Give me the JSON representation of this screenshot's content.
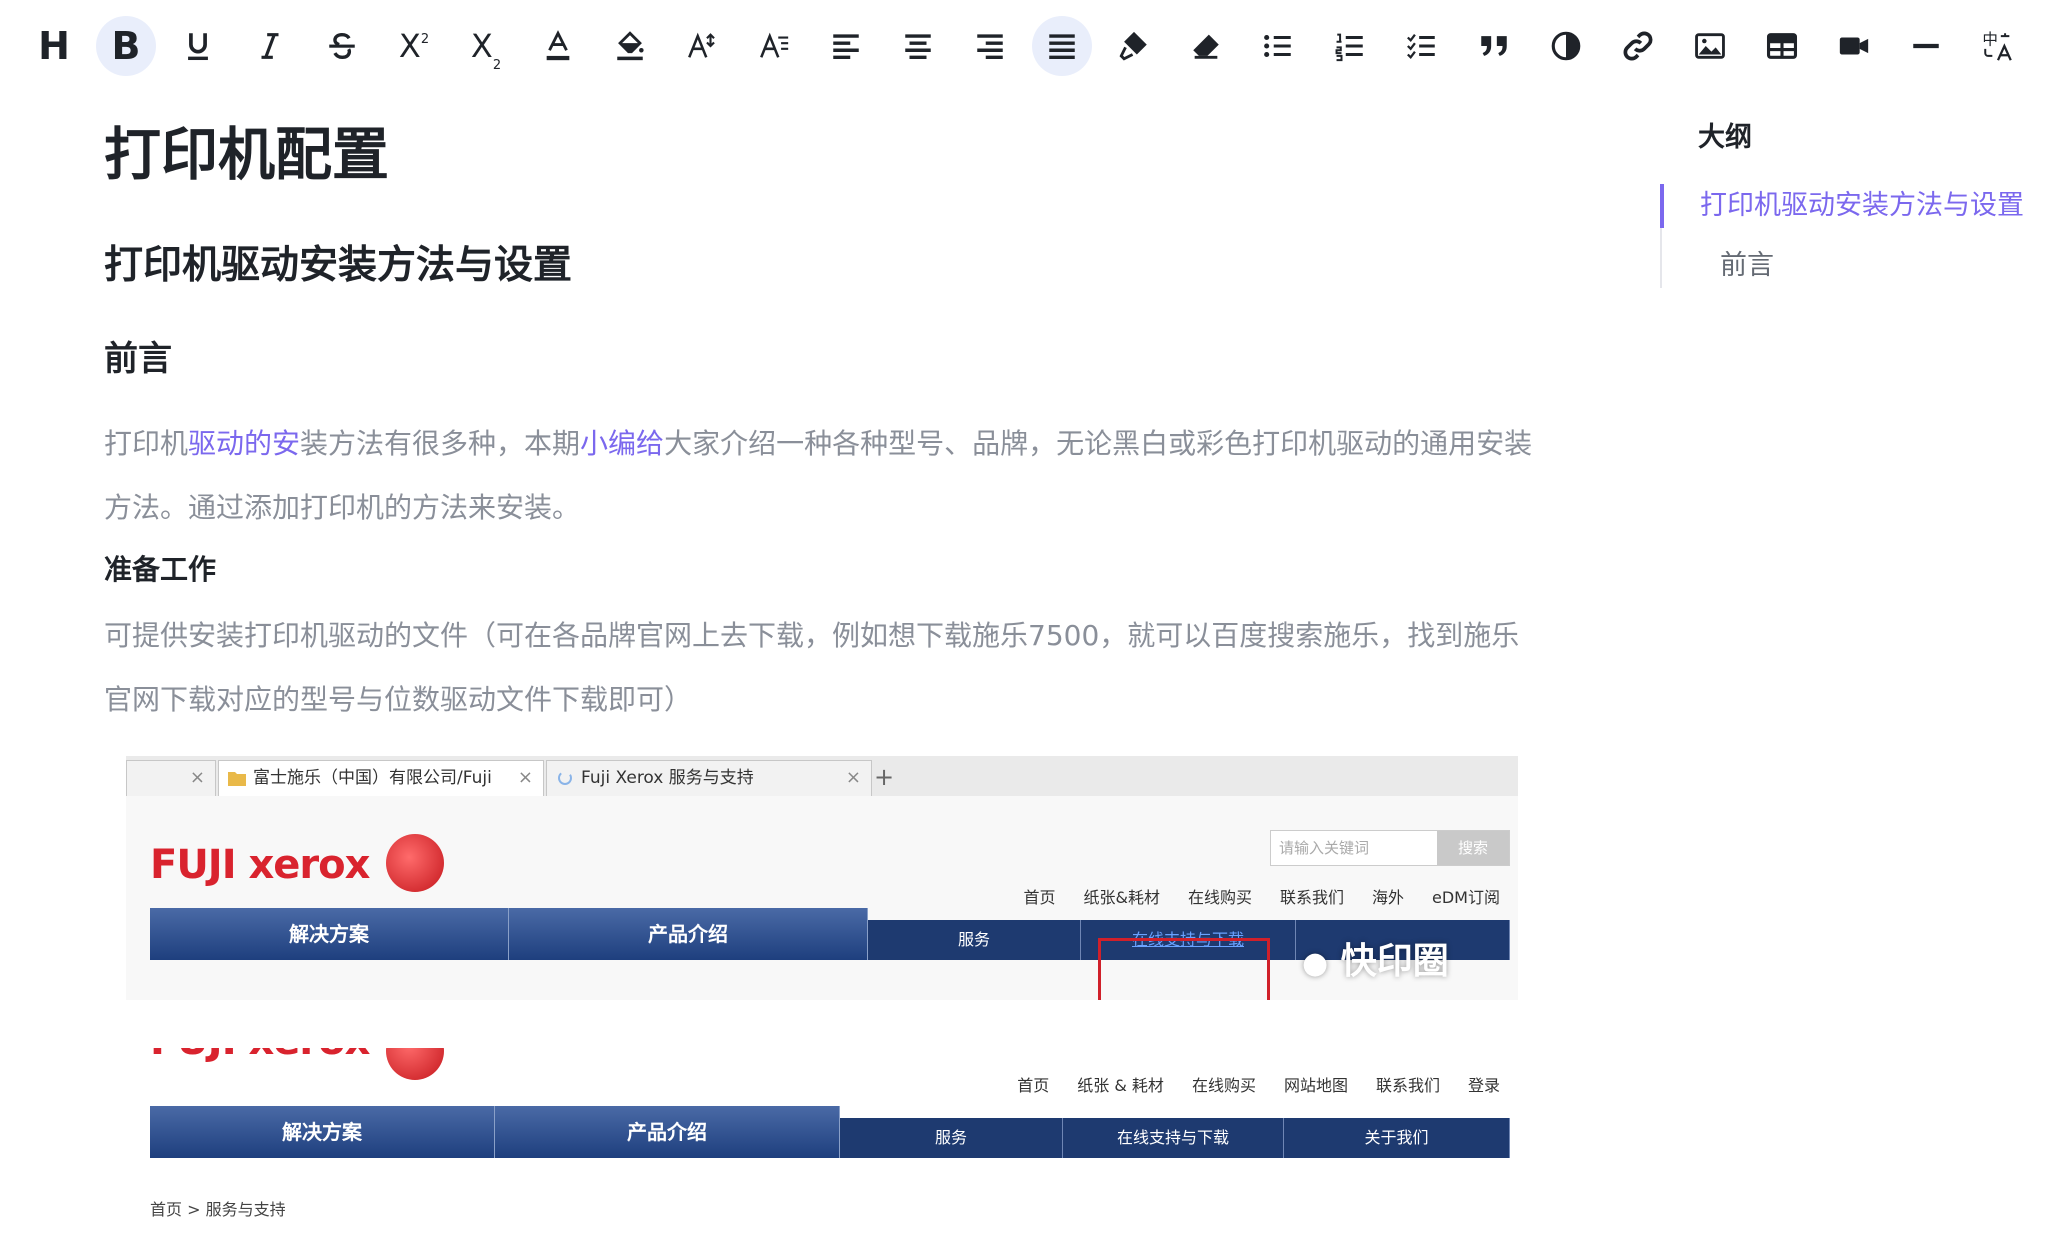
{
  "toolbar": {
    "buttons": [
      {
        "name": "heading-button",
        "icon": "heading-icon",
        "glyph": "H"
      },
      {
        "name": "bold-button",
        "icon": "bold-icon",
        "glyph": "B",
        "active": true
      },
      {
        "name": "underline-button",
        "icon": "underline-icon",
        "glyph": "U"
      },
      {
        "name": "italic-button",
        "icon": "italic-icon",
        "glyph": "I"
      },
      {
        "name": "strikethrough-button",
        "icon": "strikethrough-icon",
        "glyph": "S"
      },
      {
        "name": "superscript-button",
        "icon": "superscript-icon",
        "glyph": "X",
        "small": "2"
      },
      {
        "name": "subscript-button",
        "icon": "subscript-icon",
        "glyph": "X",
        "small": "2"
      },
      {
        "name": "font-color-button",
        "icon": "font-color-icon"
      },
      {
        "name": "highlight-button",
        "icon": "paint-bucket-icon"
      },
      {
        "name": "font-size-increase-button",
        "icon": "font-size-icon"
      },
      {
        "name": "line-height-button",
        "icon": "line-height-icon"
      },
      {
        "name": "align-left-button",
        "icon": "align-left-icon"
      },
      {
        "name": "align-center-button",
        "icon": "align-center-icon"
      },
      {
        "name": "align-right-button",
        "icon": "align-right-icon"
      },
      {
        "name": "align-justify-button",
        "icon": "align-justify-icon",
        "active": true
      },
      {
        "name": "format-painter-button",
        "icon": "format-painter-icon"
      },
      {
        "name": "clear-format-button",
        "icon": "eraser-icon"
      },
      {
        "name": "bullet-list-button",
        "icon": "bullet-list-icon"
      },
      {
        "name": "ordered-list-button",
        "icon": "ordered-list-icon"
      },
      {
        "name": "task-list-button",
        "icon": "task-list-icon"
      },
      {
        "name": "blockquote-button",
        "icon": "quote-icon"
      },
      {
        "name": "code-button",
        "icon": "contrast-icon"
      },
      {
        "name": "link-button",
        "icon": "link-icon"
      },
      {
        "name": "image-button",
        "icon": "image-icon"
      },
      {
        "name": "table-button",
        "icon": "table-icon"
      },
      {
        "name": "video-button",
        "icon": "video-icon"
      },
      {
        "name": "horizontal-rule-button",
        "icon": "horizontal-rule-icon"
      },
      {
        "name": "translate-button",
        "icon": "translate-icon"
      },
      {
        "name": "more-button",
        "icon": "chevron-left-icon"
      }
    ],
    "superscript_glyph": "X",
    "superscript_small": "2",
    "subscript_glyph": "X",
    "subscript_small": "2"
  },
  "document": {
    "title": "打印机配置",
    "h2": "打印机驱动安装方法与设置",
    "h3": "前言",
    "para1": [
      {
        "text": "打印机",
        "link": false
      },
      {
        "text": "驱动的安",
        "link": true
      },
      {
        "text": "装方法有很多种，本期",
        "link": false
      },
      {
        "text": "小编给",
        "link": true
      },
      {
        "text": "大家介绍一种各种型号、品牌，无论黑白或彩色打印机驱动的通用安装方法。通过添加打印机的方法来安装。",
        "link": false
      }
    ],
    "h4": "准备工作",
    "para2": "可提供安装打印机驱动的文件（可在各品牌官网上去下载，例如想下载施乐7500，就可以百度搜索施乐，找到施乐官网下载对应的型号与位数驱动文件下载即可）"
  },
  "screenshot1": {
    "tab1_label": "富士施乐（中国）有限公司/Fuji",
    "tab2_label": "Fuji Xerox 服务与支持",
    "tab_close": "×",
    "new_tab": "+",
    "logo": "FUJI xerox",
    "search_placeholder": "请输入关键词",
    "search_button": "搜索",
    "top_links": [
      "首页",
      "纸张&耗材",
      "在线购买",
      "联系我们",
      "海外",
      "eDM订阅"
    ],
    "nav_big": [
      "解决方案",
      "产品介绍"
    ],
    "nav_small": [
      "服务",
      "在线支持与下载"
    ],
    "watermark": "快印圈"
  },
  "screenshot2": {
    "top_links": [
      "首页",
      "纸张 & 耗材",
      "在线购买",
      "网站地图",
      "联系我们",
      "登录"
    ],
    "nav_big": [
      "解决方案",
      "产品介绍"
    ],
    "nav_small": [
      "服务",
      "在线支持与下载",
      "关于我们"
    ],
    "breadcrumb": "首页 > 服务与支持"
  },
  "outline": {
    "title": "大纲",
    "items": [
      {
        "label": "打印机驱动安装方法与设置",
        "active": true
      },
      {
        "label": "前言",
        "active": false
      }
    ]
  },
  "colors": {
    "accent": "#7b68ee",
    "body_text": "#8a8f99",
    "heading_text": "#1f2329",
    "active_button_bg": "#e9eefb",
    "xerox_red": "#d9232e",
    "nav_blue": "#1e3f7e"
  }
}
